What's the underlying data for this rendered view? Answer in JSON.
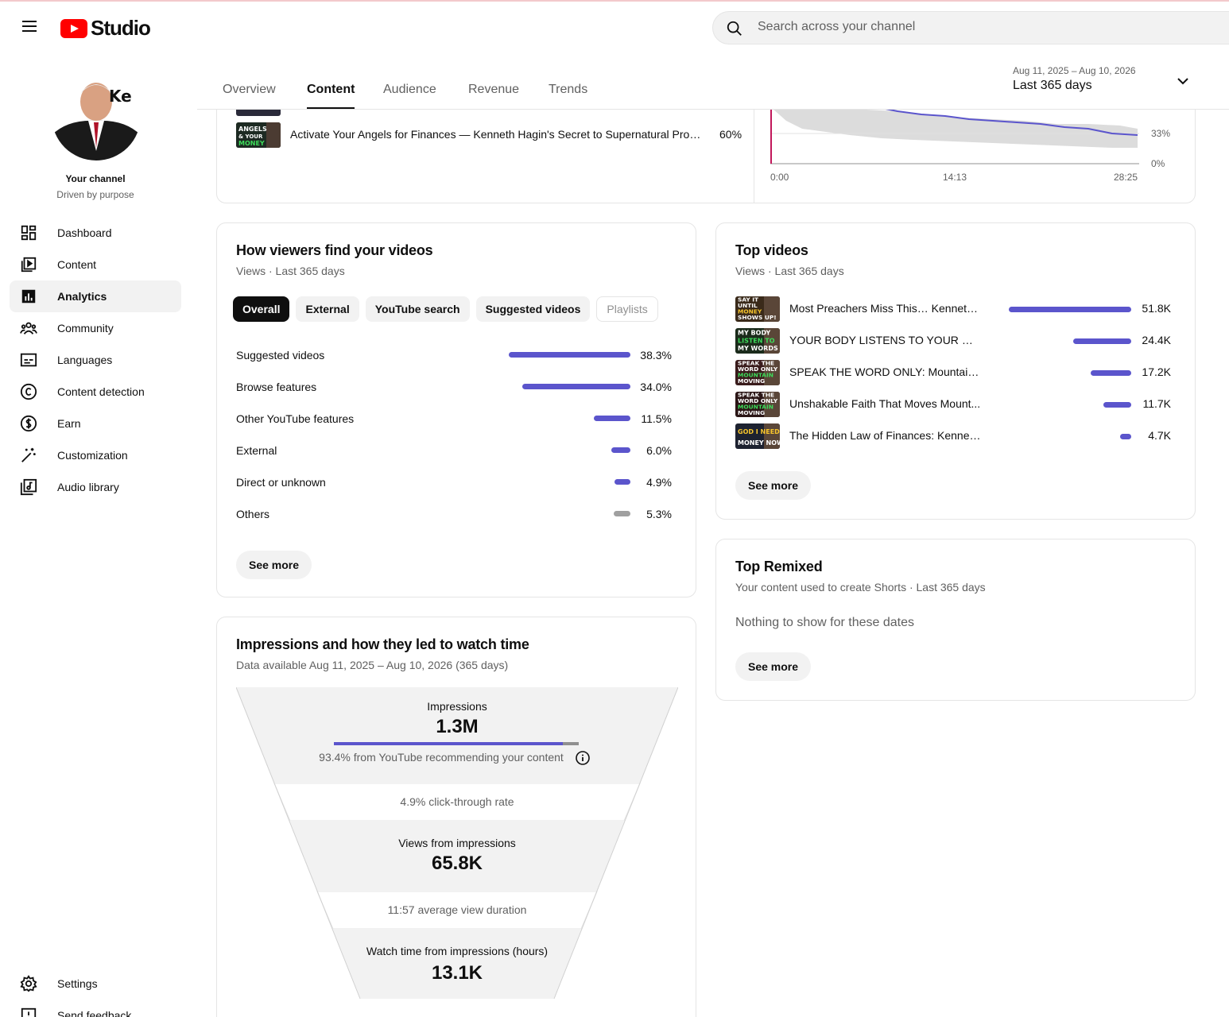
{
  "header": {
    "logo_text": "Studio",
    "search_placeholder": "Search across your channel"
  },
  "channel": {
    "name": "Your channel",
    "tagline": "Driven by purpose"
  },
  "nav": [
    {
      "label": "Dashboard",
      "icon": "dashboard-icon"
    },
    {
      "label": "Content",
      "icon": "content-icon"
    },
    {
      "label": "Analytics",
      "icon": "analytics-icon",
      "active": true
    },
    {
      "label": "Community",
      "icon": "community-icon"
    },
    {
      "label": "Languages",
      "icon": "subtitles-icon"
    },
    {
      "label": "Content detection",
      "icon": "copyright-icon"
    },
    {
      "label": "Earn",
      "icon": "dollar-icon"
    },
    {
      "label": "Customization",
      "icon": "magic-wand-icon"
    },
    {
      "label": "Audio library",
      "icon": "audio-library-icon"
    }
  ],
  "nav_bottom": [
    {
      "label": "Settings",
      "icon": "gear-icon"
    },
    {
      "label": "Send feedback",
      "icon": "feedback-icon"
    }
  ],
  "tabs": [
    "Overview",
    "Content",
    "Audience",
    "Revenue",
    "Trends"
  ],
  "active_tab": "Content",
  "date_range": {
    "sub": "Aug 11, 2025 – Aug 10, 2026",
    "main": "Last 365 days"
  },
  "retention_partial": {
    "row_title": "Activate Your Angels for Finances — Kenneth Hagin's Secret to Supernatural Provi...",
    "row_pct": "60%",
    "thumb_text": "ANGELS & YOUR MONEY",
    "y_labels": [
      "33%",
      "0%"
    ],
    "x_labels": [
      "0:00",
      "14:13",
      "28:25"
    ]
  },
  "traffic": {
    "title": "How viewers find your videos",
    "subtitle": "Views · Last 365 days",
    "chips": [
      "Overall",
      "External",
      "YouTube search",
      "Suggested videos",
      "Playlists"
    ],
    "sources": [
      {
        "label": "Suggested videos",
        "value": "38.3%",
        "pct": 38.3
      },
      {
        "label": "Browse features",
        "value": "34.0%",
        "pct": 34.0
      },
      {
        "label": "Other YouTube features",
        "value": "11.5%",
        "pct": 11.5
      },
      {
        "label": "External",
        "value": "6.0%",
        "pct": 6.0
      },
      {
        "label": "Direct or unknown",
        "value": "4.9%",
        "pct": 4.9
      },
      {
        "label": "Others",
        "value": "5.3%",
        "pct": 5.3
      }
    ],
    "see_more": "See more"
  },
  "top_videos": {
    "title": "Top videos",
    "subtitle": "Views · Last 365 days",
    "items": [
      {
        "title": "Most Preachers Miss This… Kenneth ...",
        "value": "51.8K",
        "views": 51800,
        "thumb_text": "SAY IT UNTIL MONEY SHOWS UP!"
      },
      {
        "title": "YOUR BODY LISTENS TO YOUR WOR...",
        "value": "24.4K",
        "views": 24400,
        "thumb_text": "MY BODY LISTEN TO MY WORDS"
      },
      {
        "title": "SPEAK THE WORD ONLY: Mountain-...",
        "value": "17.2K",
        "views": 17200,
        "thumb_text": "SPEAK THE WORD ONLY MOUNTAIN MOVING FAITH"
      },
      {
        "title": "Unshakable Faith That Moves Mount...",
        "value": "11.7K",
        "views": 11700,
        "thumb_text": "SPEAK THE WORD ONLY MOUNTAIN MOVING FAITH"
      },
      {
        "title": "The Hidden Law of Finances: Kenneth...",
        "value": "4.7K",
        "views": 4700,
        "thumb_text": "GOD I NEED MONEY NOW!"
      }
    ],
    "see_more": "See more"
  },
  "remixed": {
    "title": "Top Remixed",
    "subtitle": "Your content used to create Shorts · Last 365 days",
    "empty": "Nothing to show for these dates",
    "see_more": "See more"
  },
  "funnel": {
    "title": "Impressions and how they led to watch time",
    "subtitle": "Data available Aug 11, 2025 – Aug 10, 2026 (365 days)",
    "impressions_label": "Impressions",
    "impressions_value": "1.3M",
    "recommend_text": "93.4% from YouTube recommending your content",
    "recommend_fraction": 0.934,
    "ctr_text": "4.9% click-through rate",
    "views_label": "Views from impressions",
    "views_value": "65.8K",
    "avd_text": "11:57 average view duration",
    "watch_label": "Watch time from impressions (hours)",
    "watch_value": "13.1K"
  },
  "colors": {
    "accent": "#5b55cc",
    "brand_red": "#ff0000"
  }
}
